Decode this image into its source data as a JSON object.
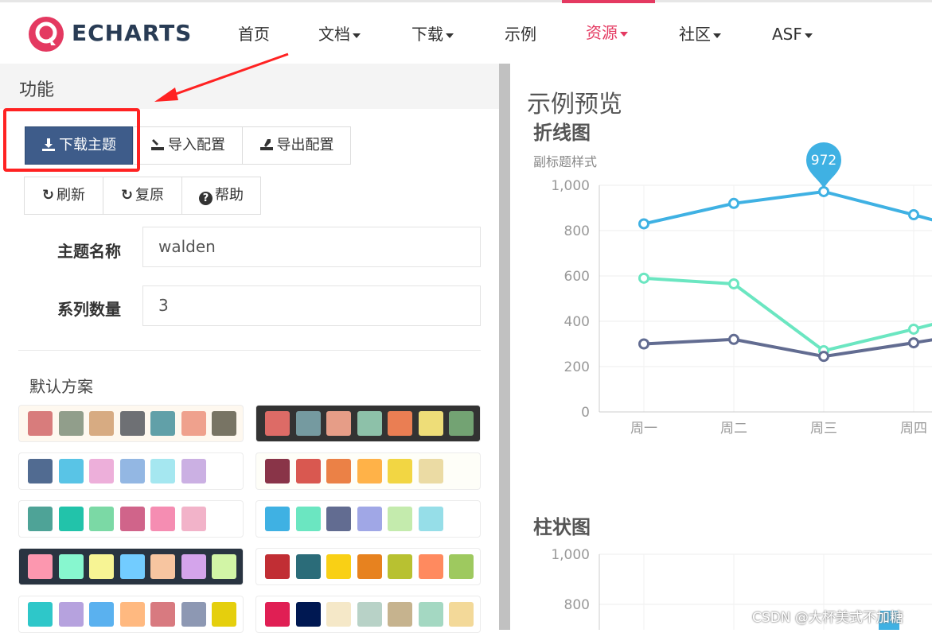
{
  "nav": {
    "logo": "ECHARTS",
    "items": [
      {
        "label": "首页",
        "dropdown": false
      },
      {
        "label": "文档",
        "dropdown": true
      },
      {
        "label": "下载",
        "dropdown": true
      },
      {
        "label": "示例",
        "dropdown": false
      },
      {
        "label": "资源",
        "dropdown": true,
        "active": true
      },
      {
        "label": "社区",
        "dropdown": true
      },
      {
        "label": "ASF",
        "dropdown": true
      }
    ],
    "accent": "#e43961"
  },
  "panel": {
    "title": "功能",
    "buttons": {
      "download": "下载主题",
      "import": "导入配置",
      "export": "导出配置",
      "refresh": "刷新",
      "reset": "复原",
      "help": "帮助"
    },
    "theme_name_label": "主题名称",
    "theme_name_value": "walden",
    "series_count_label": "系列数量",
    "series_count_value": "3",
    "default_schemes_label": "默认方案",
    "themes": [
      {
        "bg": "#fef8ef",
        "colors": [
          "#d87c7c",
          "#919e8b",
          "#d7ab82",
          "#6e7074",
          "#61a0a8",
          "#efa18d",
          "#787464"
        ]
      },
      {
        "bg": "#333333",
        "colors": [
          "#dd6b66",
          "#759aa0",
          "#e69d87",
          "#8dc1a9",
          "#ea7e53",
          "#eedd78",
          "#73a373"
        ]
      },
      {
        "bg": "#ffffff",
        "colors": [
          "#516b91",
          "#59c4e6",
          "#edafda",
          "#93b7e3",
          "#a5e7f0",
          "#cbb0e3"
        ]
      },
      {
        "bg": "#fefef8",
        "colors": [
          "#893448",
          "#d95850",
          "#eb8146",
          "#ffb248",
          "#f2d643",
          "#ebdba4"
        ]
      },
      {
        "bg": "#ffffff",
        "colors": [
          "#4ea397",
          "#22c3aa",
          "#7bd9a5",
          "#d0648a",
          "#f58db2",
          "#f2b3c9"
        ]
      },
      {
        "bg": "#ffffff",
        "colors": [
          "#3fb1e3",
          "#6be6c1",
          "#626c91",
          "#a0a7e6",
          "#c4ebad",
          "#96dee8"
        ]
      },
      {
        "bg": "#293441",
        "colors": [
          "#fc97af",
          "#87f7cf",
          "#f7f494",
          "#72ccff",
          "#f7c5a0",
          "#d4a4eb",
          "#d2f5a6"
        ]
      },
      {
        "bg": "#ffffff",
        "colors": [
          "#c12e34",
          "#2b6c79",
          "#f9d015",
          "#e7821f",
          "#b8c131",
          "#ff8a5f",
          "#9ec95f"
        ]
      },
      {
        "bg": "#ffffff",
        "colors": [
          "#2ec7c9",
          "#b6a2de",
          "#5ab1ef",
          "#ffb980",
          "#d87a80",
          "#8d98b3",
          "#e5cf0d"
        ]
      },
      {
        "bg": "#ffffff",
        "colors": [
          "#e01f54",
          "#001852",
          "#f5e8c8",
          "#b8d2c7",
          "#c6b38e",
          "#a4d8c2",
          "#f3d999"
        ]
      }
    ]
  },
  "preview": {
    "title": "示例预览",
    "line_chart_title": "折线图",
    "line_chart_subtitle": "副标题样式",
    "bar_chart_title": "柱状图"
  },
  "chart_data": [
    {
      "type": "line",
      "title": "折线图",
      "subtitle": "副标题样式",
      "categories": [
        "周一",
        "周二",
        "周三",
        "周四"
      ],
      "ylim": [
        0,
        1000
      ],
      "yticks": [
        "0",
        "200",
        "400",
        "600",
        "800",
        "1,000"
      ],
      "series": [
        {
          "values": [
            830,
            920,
            972,
            870
          ],
          "color": "#3fb1e3"
        },
        {
          "values": [
            590,
            565,
            270,
            365
          ],
          "color": "#6be6c1"
        },
        {
          "values": [
            300,
            320,
            245,
            305
          ],
          "color": "#626c91"
        }
      ],
      "markPoint": {
        "label": "972"
      }
    },
    {
      "type": "bar",
      "title": "柱状图",
      "yticks": [
        "800",
        "1,000"
      ]
    }
  ],
  "watermark": "CSDN @大杯美式不加糖"
}
